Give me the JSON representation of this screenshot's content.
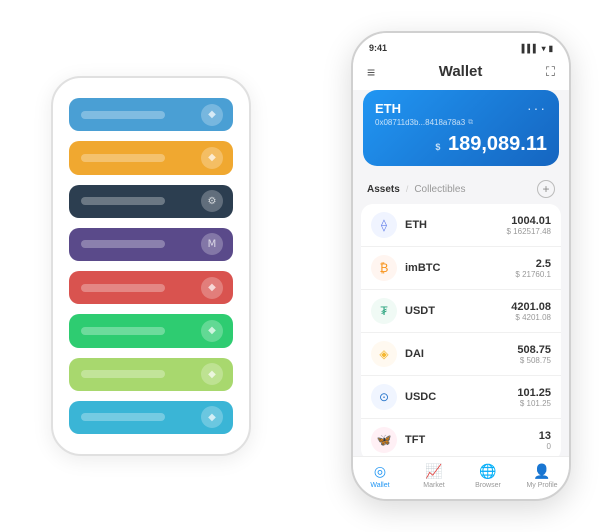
{
  "scene": {
    "background_phone": {
      "cards": [
        {
          "color": "blue",
          "class": "card-blue",
          "icon": "◆"
        },
        {
          "color": "orange",
          "class": "card-orange",
          "icon": "◆"
        },
        {
          "color": "dark",
          "class": "card-dark",
          "icon": "⚙"
        },
        {
          "color": "purple",
          "class": "card-purple",
          "icon": "Ⅿ"
        },
        {
          "color": "red",
          "class": "card-red",
          "icon": "◆"
        },
        {
          "color": "green",
          "class": "card-green",
          "icon": "◆"
        },
        {
          "color": "lightgreen",
          "class": "card-lightgreen",
          "icon": "◆"
        },
        {
          "color": "cyan",
          "class": "card-cyan",
          "icon": "◆"
        }
      ]
    },
    "main_phone": {
      "status_bar": {
        "time": "9:41",
        "signal": "▌▌▌",
        "wifi": "▾",
        "battery": "▮"
      },
      "header": {
        "menu_icon": "≡",
        "title": "Wallet",
        "expand_icon": "⛶"
      },
      "eth_card": {
        "title": "ETH",
        "dots": "···",
        "address": "0x08711d3b...8418a78a3",
        "copy_icon": "⧉",
        "balance_label": "$",
        "balance": "189,089.11"
      },
      "assets_section": {
        "tab_active": "Assets",
        "divider": "/",
        "tab_inactive": "Collectibles",
        "add_icon": "+"
      },
      "assets": [
        {
          "id": "eth",
          "name": "ETH",
          "icon": "⟠",
          "icon_class": "asset-icon-eth",
          "amount": "1004.01",
          "usd": "$ 162517.48"
        },
        {
          "id": "imbtc",
          "name": "imBTC",
          "icon": "₿",
          "icon_class": "asset-icon-imbtc",
          "amount": "2.5",
          "usd": "$ 21760.1"
        },
        {
          "id": "usdt",
          "name": "USDT",
          "icon": "₮",
          "icon_class": "asset-icon-usdt",
          "amount": "4201.08",
          "usd": "$ 4201.08"
        },
        {
          "id": "dai",
          "name": "DAI",
          "icon": "◈",
          "icon_class": "asset-icon-dai",
          "amount": "508.75",
          "usd": "$ 508.75"
        },
        {
          "id": "usdc",
          "name": "USDC",
          "icon": "⊙",
          "icon_class": "asset-icon-usdc",
          "amount": "101.25",
          "usd": "$ 101.25"
        },
        {
          "id": "tft",
          "name": "TFT",
          "icon": "🦋",
          "icon_class": "asset-icon-tft",
          "amount": "13",
          "usd": "0"
        }
      ],
      "nav": [
        {
          "id": "wallet",
          "icon": "◎",
          "label": "Wallet",
          "active": true
        },
        {
          "id": "market",
          "icon": "📈",
          "label": "Market",
          "active": false
        },
        {
          "id": "browser",
          "icon": "🌐",
          "label": "Browser",
          "active": false
        },
        {
          "id": "profile",
          "icon": "👤",
          "label": "My Profile",
          "active": false
        }
      ]
    }
  }
}
